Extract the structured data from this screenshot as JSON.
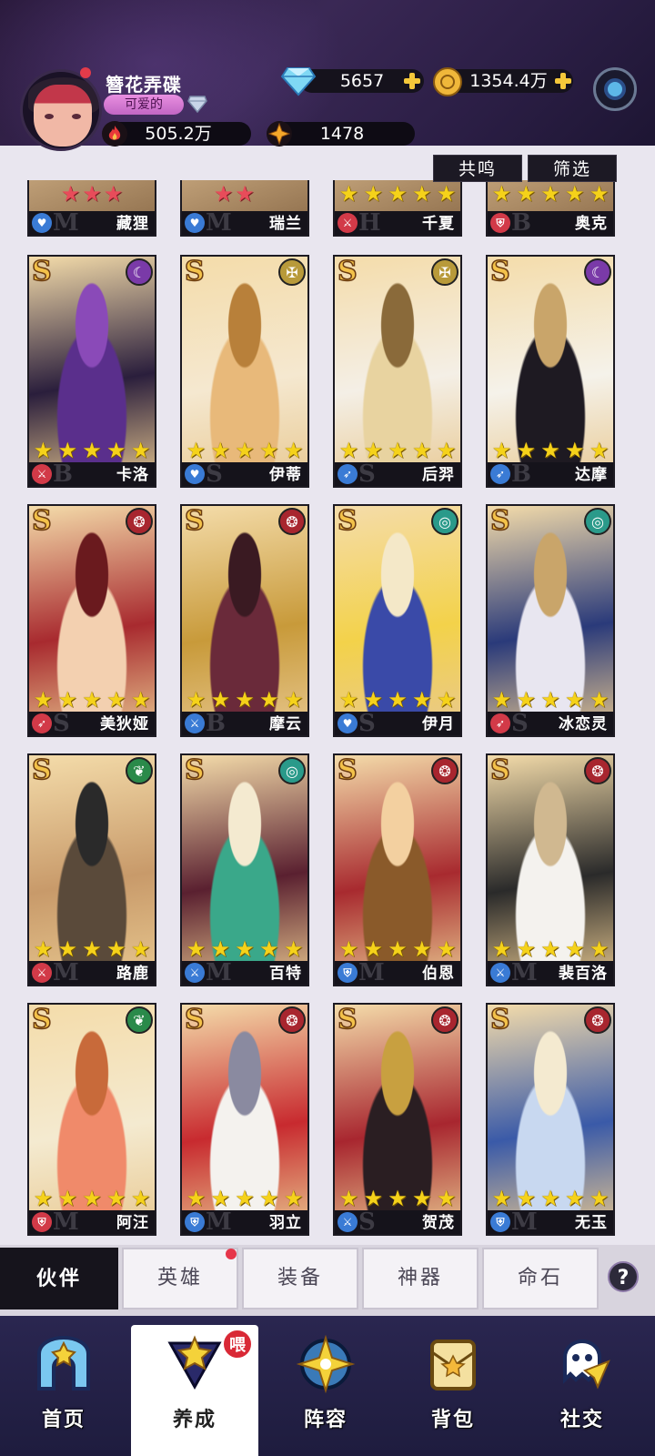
{
  "player": {
    "name": "簪花弄碟",
    "title": "可爱的",
    "power": "505.2万",
    "energy": "1478"
  },
  "currency": {
    "gems": "5657",
    "gold": "1354.4万"
  },
  "filters": {
    "resonance": "共鸣",
    "filter": "筛选"
  },
  "cards_top": [
    {
      "name": "藏狸",
      "stars": 3,
      "star_color": "red",
      "tier": "M",
      "role_color": "#3a7bd5",
      "role": "heart"
    },
    {
      "name": "瑞兰",
      "stars": 2,
      "star_color": "red",
      "tier": "M",
      "role_color": "#3a7bd5",
      "role": "heart"
    },
    {
      "name": "千夏",
      "stars": 5,
      "star_color": "gold",
      "tier": "H",
      "role_color": "#d23a48",
      "role": "sword"
    },
    {
      "name": "奥克",
      "stars": 5,
      "star_color": "gold",
      "tier": "B",
      "role_color": "#d23a48",
      "role": "shield"
    }
  ],
  "cards": [
    {
      "name": "卡洛",
      "grade": "S",
      "tier": "B",
      "faction": "moon",
      "faction_color": "#7a3aa8",
      "role": "sword",
      "role_color": "#d23a48",
      "art": [
        "#5a2f8c",
        "#2a1e3c",
        "#8a4ab8"
      ]
    },
    {
      "name": "伊蒂",
      "grade": "S",
      "tier": "S",
      "faction": "cross",
      "faction_color": "#b89a3a",
      "role": "heart",
      "role_color": "#3a7bd5",
      "art": [
        "#e8b97a",
        "#f5e8d0",
        "#b8803a"
      ]
    },
    {
      "name": "后羿",
      "grade": "S",
      "tier": "S",
      "faction": "cross",
      "faction_color": "#b89a3a",
      "role": "bow",
      "role_color": "#3a7bd5",
      "art": [
        "#e8d3a0",
        "#f4efe6",
        "#8a6a3a"
      ]
    },
    {
      "name": "达摩",
      "grade": "S",
      "tier": "B",
      "faction": "moon",
      "faction_color": "#7a3aa8",
      "role": "bow",
      "role_color": "#3a7bd5",
      "art": [
        "#1e1a22",
        "#f5f2ea",
        "#c9a56a"
      ]
    },
    {
      "name": "美狄娅",
      "grade": "S",
      "tier": "S",
      "faction": "fire",
      "faction_color": "#a8262f",
      "role": "bow",
      "role_color": "#d23a48",
      "art": [
        "#f3d0b0",
        "#a82a2f",
        "#6a1a1e"
      ]
    },
    {
      "name": "摩云",
      "grade": "S",
      "tier": "B",
      "faction": "fire",
      "faction_color": "#a8262f",
      "role": "sword",
      "role_color": "#3a7bd5",
      "art": [
        "#6a2a3a",
        "#c89a3a",
        "#3a1a22"
      ]
    },
    {
      "name": "伊月",
      "grade": "S",
      "tier": "S",
      "faction": "water",
      "faction_color": "#2a9a8a",
      "role": "heart",
      "role_color": "#3a7bd5",
      "art": [
        "#3a4aa8",
        "#f3d24a",
        "#f4e8c8"
      ]
    },
    {
      "name": "冰恋灵",
      "grade": "S",
      "tier": "S",
      "faction": "water",
      "faction_color": "#2a9a8a",
      "role": "bow",
      "role_color": "#d23a48",
      "art": [
        "#e8e6f0",
        "#2a3a7a",
        "#c9a56a"
      ]
    },
    {
      "name": "路鹿",
      "grade": "S",
      "tier": "M",
      "faction": "leaf",
      "faction_color": "#2a8a4a",
      "role": "sword",
      "role_color": "#d23a48",
      "art": [
        "#5a4a3a",
        "#c89a6a",
        "#2a2a2a"
      ]
    },
    {
      "name": "百特",
      "grade": "S",
      "tier": "M",
      "faction": "water",
      "faction_color": "#2a9a8a",
      "role": "sword",
      "role_color": "#3a7bd5",
      "art": [
        "#3aa88a",
        "#5a2030",
        "#f4ead0"
      ]
    },
    {
      "name": "伯恩",
      "grade": "S",
      "tier": "M",
      "faction": "fire",
      "faction_color": "#a8262f",
      "role": "shield",
      "role_color": "#3a7bd5",
      "art": [
        "#8a5a2a",
        "#a82a2f",
        "#f3d0a0"
      ]
    },
    {
      "name": "裴百洛",
      "grade": "S",
      "tier": "M",
      "faction": "fire",
      "faction_color": "#a8262f",
      "role": "sword",
      "role_color": "#3a7bd5",
      "art": [
        "#f4f2ee",
        "#2a2a2a",
        "#d0b890"
      ]
    },
    {
      "name": "阿汪",
      "grade": "S",
      "tier": "M",
      "faction": "leaf",
      "faction_color": "#2a8a4a",
      "role": "shield",
      "role_color": "#d23a48",
      "art": [
        "#f08a6a",
        "#f4ead0",
        "#c86a3a"
      ]
    },
    {
      "name": "羽立",
      "grade": "S",
      "tier": "M",
      "faction": "fire",
      "faction_color": "#a8262f",
      "role": "shield",
      "role_color": "#3a7bd5",
      "art": [
        "#f4f2ee",
        "#c82a2f",
        "#8a8aa0"
      ]
    },
    {
      "name": "贺茂",
      "grade": "S",
      "tier": "S",
      "faction": "fire",
      "faction_color": "#a8262f",
      "role": "sword",
      "role_color": "#3a7bd5",
      "art": [
        "#2a1e22",
        "#a8262f",
        "#c8a040"
      ]
    },
    {
      "name": "无玉",
      "grade": "S",
      "tier": "M",
      "faction": "fire",
      "faction_color": "#a8262f",
      "role": "shield",
      "role_color": "#3a7bd5",
      "art": [
        "#c8d8f0",
        "#3a5aa8",
        "#f4ead0"
      ]
    }
  ],
  "subtabs": {
    "active": "伙伴",
    "hero": "英雄",
    "equipment": "装备",
    "artifact": "神器",
    "fate_stone": "命石",
    "help": "?"
  },
  "nav": {
    "home": "首页",
    "cultivate": "养成",
    "cultivate_badge": "喂",
    "lineup": "阵容",
    "backpack": "背包",
    "social": "社交"
  },
  "colors": {
    "header_bg": "#2a1a3c",
    "star_gold": "#f5d21a",
    "star_red": "#e84c5a",
    "nav_bg": "#2a2650"
  }
}
